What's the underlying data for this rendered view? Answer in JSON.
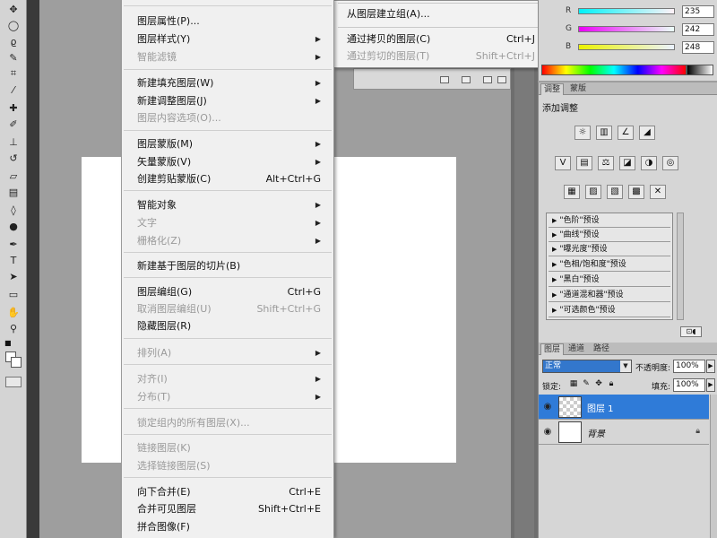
{
  "menu": {
    "items": [
      {
        "label": "图层属性(P)...",
        "shortcut": "",
        "submenu": false,
        "disabled": false
      },
      {
        "label": "图层样式(Y)",
        "shortcut": "",
        "submenu": true,
        "disabled": false
      },
      {
        "label": "智能滤镜",
        "shortcut": "",
        "submenu": true,
        "disabled": true
      },
      {
        "label": "新建填充图层(W)",
        "shortcut": "",
        "submenu": true,
        "disabled": false
      },
      {
        "label": "新建调整图层(J)",
        "shortcut": "",
        "submenu": true,
        "disabled": false
      },
      {
        "label": "图层内容选项(O)...",
        "shortcut": "",
        "submenu": false,
        "disabled": true
      },
      {
        "label": "图层蒙版(M)",
        "shortcut": "",
        "submenu": true,
        "disabled": false
      },
      {
        "label": "矢量蒙版(V)",
        "shortcut": "",
        "submenu": true,
        "disabled": false
      },
      {
        "label": "创建剪贴蒙版(C)",
        "shortcut": "Alt+Ctrl+G",
        "submenu": false,
        "disabled": false
      },
      {
        "label": "智能对象",
        "shortcut": "",
        "submenu": true,
        "disabled": false
      },
      {
        "label": "文字",
        "shortcut": "",
        "submenu": true,
        "disabled": true
      },
      {
        "label": "栅格化(Z)",
        "shortcut": "",
        "submenu": true,
        "disabled": true
      },
      {
        "label": "新建基于图层的切片(B)",
        "shortcut": "",
        "submenu": false,
        "disabled": false
      },
      {
        "label": "图层编组(G)",
        "shortcut": "Ctrl+G",
        "submenu": false,
        "disabled": false
      },
      {
        "label": "取消图层编组(U)",
        "shortcut": "Shift+Ctrl+G",
        "submenu": false,
        "disabled": true
      },
      {
        "label": "隐藏图层(R)",
        "shortcut": "",
        "submenu": false,
        "disabled": false
      },
      {
        "label": "排列(A)",
        "shortcut": "",
        "submenu": true,
        "disabled": true
      },
      {
        "label": "对齐(I)",
        "shortcut": "",
        "submenu": true,
        "disabled": true
      },
      {
        "label": "分布(T)",
        "shortcut": "",
        "submenu": true,
        "disabled": true
      },
      {
        "label": "锁定组内的所有图层(X)...",
        "shortcut": "",
        "submenu": false,
        "disabled": true
      },
      {
        "label": "链接图层(K)",
        "shortcut": "",
        "submenu": false,
        "disabled": true
      },
      {
        "label": "选择链接图层(S)",
        "shortcut": "",
        "submenu": false,
        "disabled": true
      },
      {
        "label": "向下合并(E)",
        "shortcut": "Ctrl+E",
        "submenu": false,
        "disabled": false
      },
      {
        "label": "合并可见图层",
        "shortcut": "Shift+Ctrl+E",
        "submenu": false,
        "disabled": false
      },
      {
        "label": "拼合图像(F)",
        "shortcut": "",
        "submenu": false,
        "disabled": false
      }
    ]
  },
  "submenu": {
    "items": [
      {
        "label": "从图层建立组(A)...",
        "shortcut": "",
        "disabled": false
      },
      {
        "label": "通过拷贝的图层(C)",
        "shortcut": "Ctrl+J",
        "disabled": false
      },
      {
        "label": "通过剪切的图层(T)",
        "shortcut": "Shift+Ctrl+J",
        "disabled": true
      }
    ]
  },
  "color_panel": {
    "channels": [
      {
        "label": "R",
        "value": "235",
        "gradient": "linear-gradient(to right, #00f2f8, #fff2f8)"
      },
      {
        "label": "G",
        "value": "242",
        "gradient": "linear-gradient(to right, #eb00f8, #ebfff8)"
      },
      {
        "label": "B",
        "value": "248",
        "gradient": "linear-gradient(to right, #ebf200, #ebf2ff)"
      }
    ]
  },
  "adjustments": {
    "tabs": [
      "调整",
      "蒙版"
    ],
    "title": "添加调整",
    "icons_row1": [
      "☼",
      "▥",
      "∠",
      "◢"
    ],
    "icons_row2": [
      "V",
      "▤",
      "⚖",
      "◪",
      "◑",
      "◎"
    ],
    "icons_row3": [
      "▦",
      "▨",
      "▧",
      "▩",
      "✕"
    ],
    "presets": [
      "\"色阶\"预设",
      "\"曲线\"预设",
      "\"曝光度\"预设",
      "\"色相/饱和度\"预设",
      "\"黑白\"预设",
      "\"通道混和器\"预设",
      "\"可选颜色\"预设"
    ],
    "footer_icon": "⊡◖"
  },
  "layers": {
    "tabs": [
      "图层",
      "通道",
      "路径"
    ],
    "blend_mode": "正常",
    "opacity_label": "不透明度:",
    "opacity_value": "100%",
    "lock_label": "锁定:",
    "fill_label": "填充:",
    "fill_value": "100%",
    "rows": [
      {
        "name": "图层 1"
      },
      {
        "name": "背景"
      }
    ]
  },
  "accent": {
    "selection_blue": "#2f7bd8",
    "canvas_bg": "#9e9e9e"
  }
}
